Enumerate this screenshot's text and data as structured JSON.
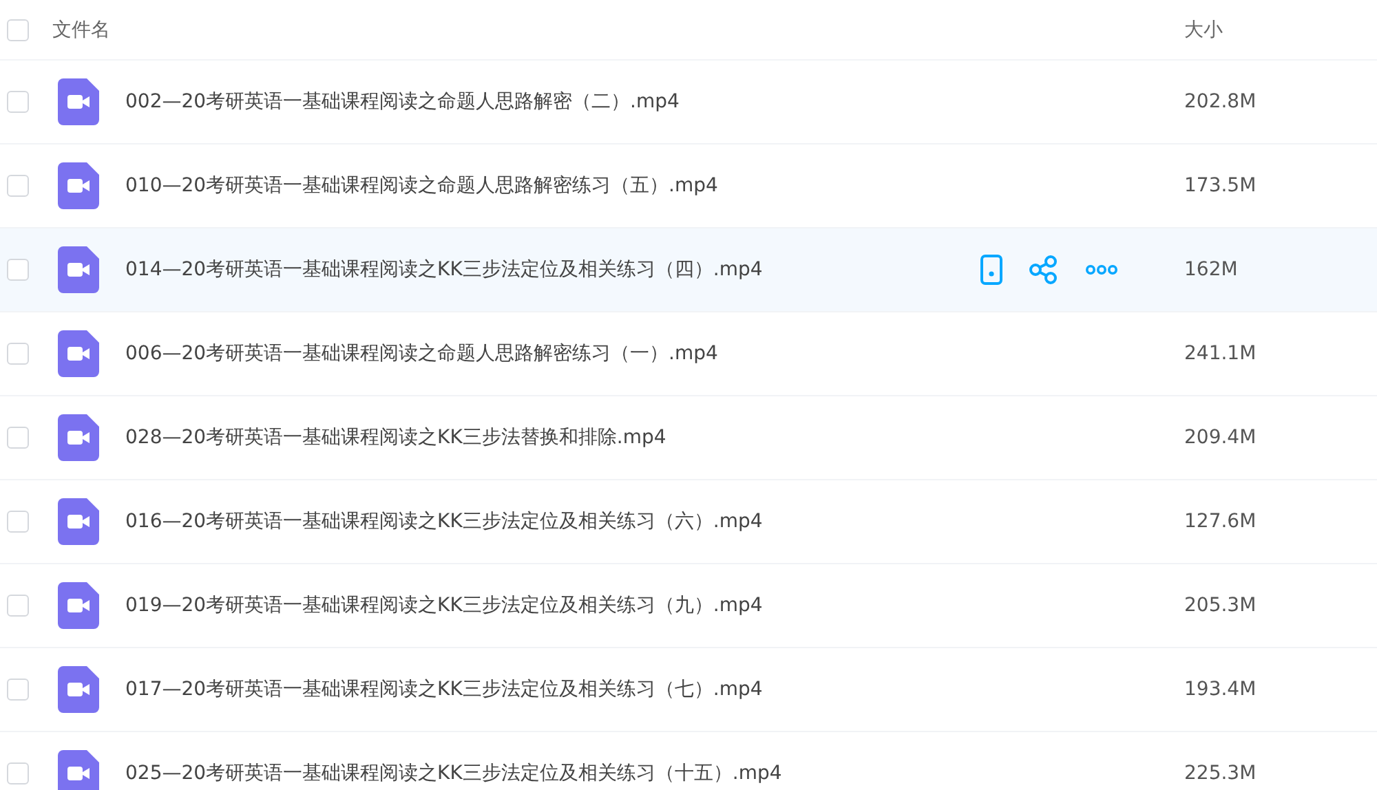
{
  "header": {
    "name_label": "文件名",
    "size_label": "大小",
    "checked": false
  },
  "files": [
    {
      "name": "002—20考研英语一基础课程阅读之命题人思路解密（二）.mp4",
      "size": "202.8M",
      "checked": false,
      "hovered": false
    },
    {
      "name": "010—20考研英语一基础课程阅读之命题人思路解密练习（五）.mp4",
      "size": "173.5M",
      "checked": false,
      "hovered": false
    },
    {
      "name": "014—20考研英语一基础课程阅读之KK三步法定位及相关练习（四）.mp4",
      "size": "162M",
      "checked": false,
      "hovered": true
    },
    {
      "name": "006—20考研英语一基础课程阅读之命题人思路解密练习（一）.mp4",
      "size": "241.1M",
      "checked": false,
      "hovered": false
    },
    {
      "name": "028—20考研英语一基础课程阅读之KK三步法替换和排除.mp4",
      "size": "209.4M",
      "checked": false,
      "hovered": false
    },
    {
      "name": "016—20考研英语一基础课程阅读之KK三步法定位及相关练习（六）.mp4",
      "size": "127.6M",
      "checked": false,
      "hovered": false
    },
    {
      "name": "019—20考研英语一基础课程阅读之KK三步法定位及相关练习（九）.mp4",
      "size": "205.3M",
      "checked": false,
      "hovered": false
    },
    {
      "name": "017—20考研英语一基础课程阅读之KK三步法定位及相关练习（七）.mp4",
      "size": "193.4M",
      "checked": false,
      "hovered": false
    },
    {
      "name": "025—20考研英语一基础课程阅读之KK三步法定位及相关练习（十五）.mp4",
      "size": "225.3M",
      "checked": false,
      "hovered": false
    }
  ]
}
